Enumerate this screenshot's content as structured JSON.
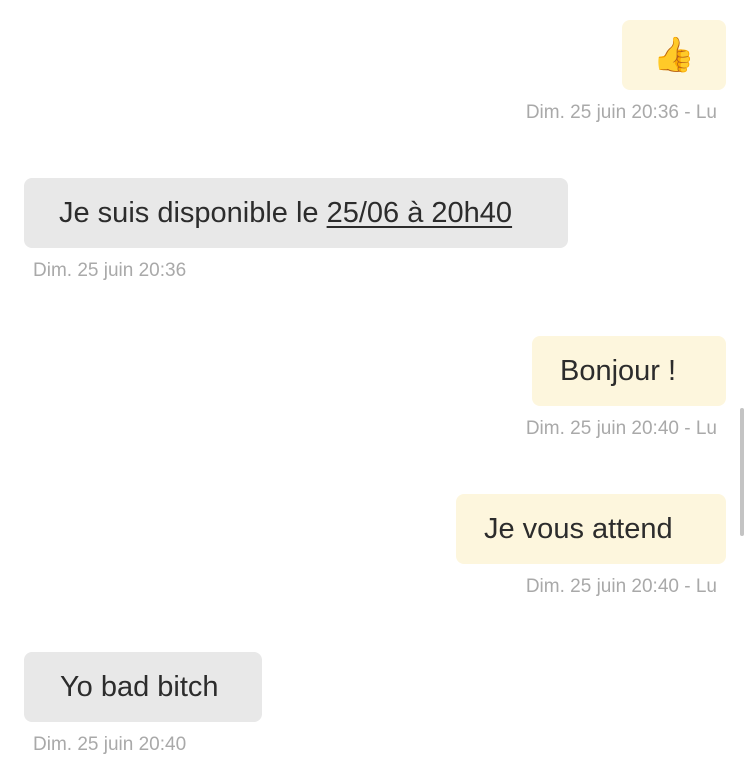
{
  "messages": [
    {
      "direction": "out",
      "emoji": "👍",
      "meta": "Dim. 25 juin 20:36 - Lu"
    },
    {
      "direction": "in",
      "text_prefix": "Je suis disponible le ",
      "text_link": "25/06 à 20h40",
      "meta": "Dim. 25 juin 20:36"
    },
    {
      "direction": "out",
      "text": "Bonjour !",
      "meta": "Dim. 25 juin 20:40 - Lu"
    },
    {
      "direction": "out",
      "text": "Je vous attend",
      "meta": "Dim. 25 juin 20:40 - Lu"
    },
    {
      "direction": "in",
      "text": "Yo bad bitch",
      "meta": "Dim. 25 juin 20:40"
    }
  ],
  "colors": {
    "outgoing_bubble": "#fdf6dd",
    "incoming_bubble": "#e8e8e8",
    "meta_text": "#a9a9a9",
    "message_text": "#2c2c2c"
  }
}
